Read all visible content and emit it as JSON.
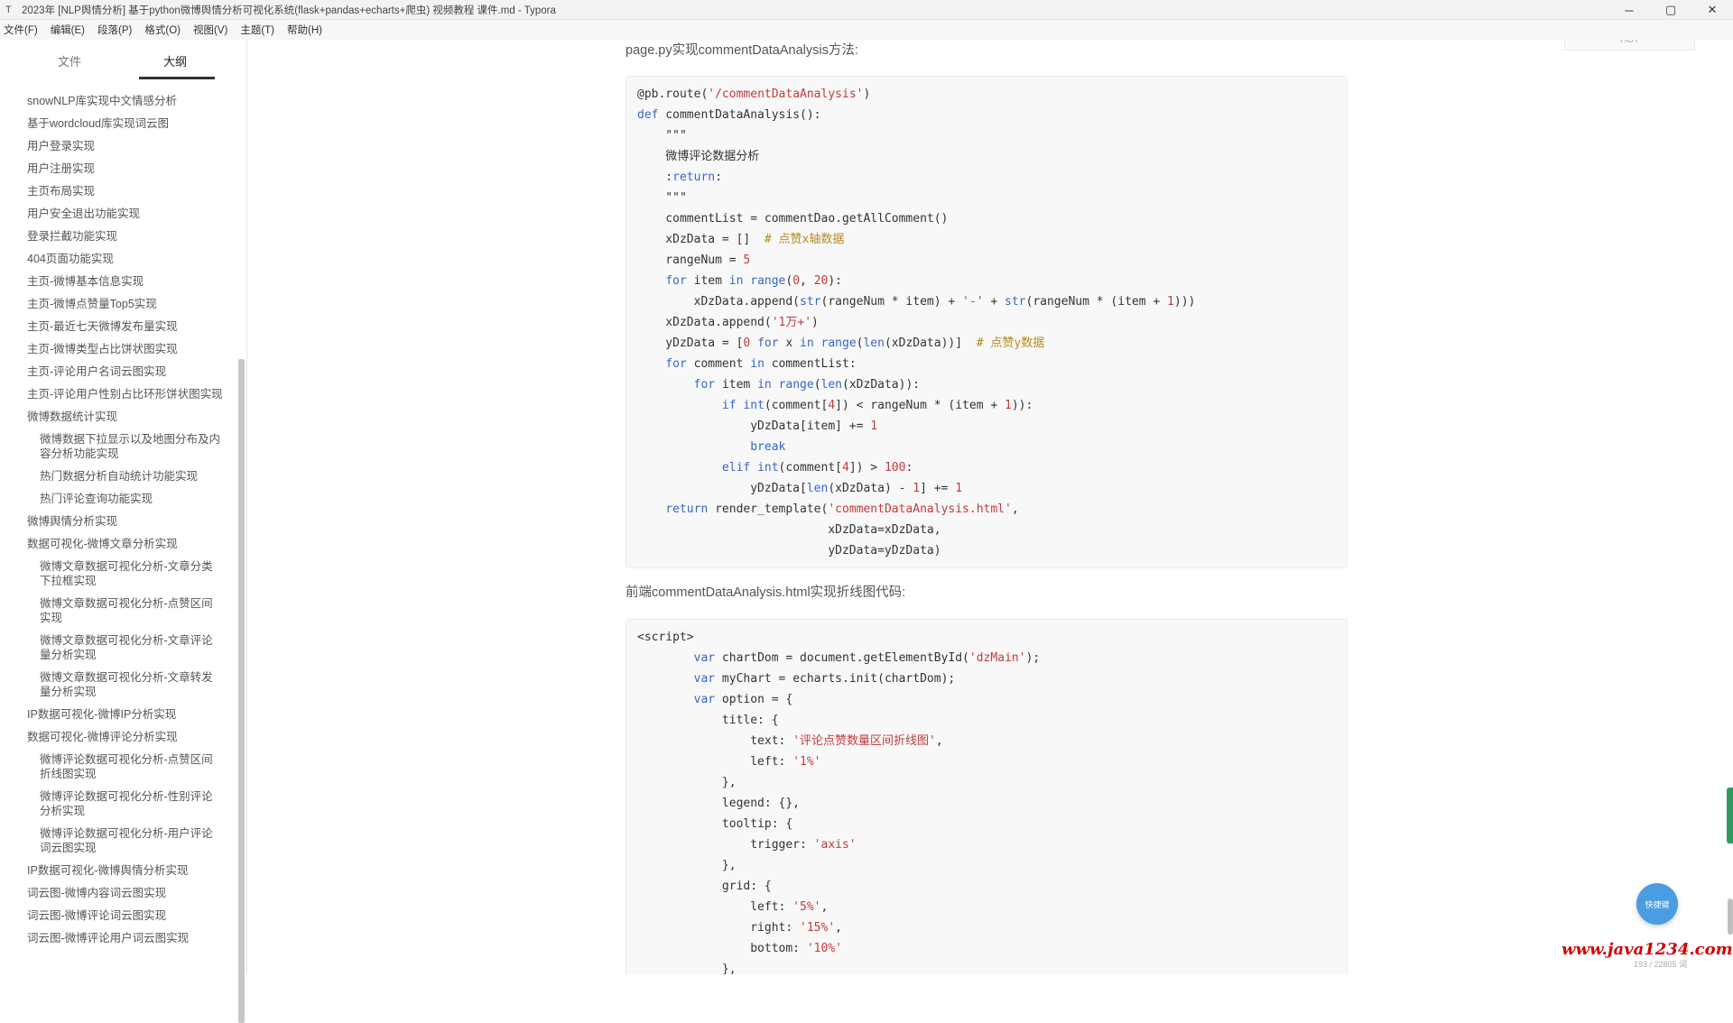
{
  "window": {
    "title": "2023年 [NLP舆情分析] 基于python微博舆情分析可视化系统(flask+pandas+echarts+爬虫) 视频教程 课件.md - Typora",
    "minimize_glyph": "─",
    "maximize_glyph": "▢",
    "close_glyph": "✕",
    "icon_glyph": "T"
  },
  "menu": {
    "items": [
      "文件(F)",
      "编辑(E)",
      "段落(P)",
      "格式(O)",
      "视图(V)",
      "主题(T)",
      "帮助(H)"
    ]
  },
  "sidebar": {
    "tab_files": "文件",
    "tab_outline": "大纲",
    "outline": [
      {
        "text": "snowNLP库实现中文情感分析",
        "level": 2
      },
      {
        "text": "基于wordcloud库实现词云图",
        "level": 2
      },
      {
        "text": "用户登录实现",
        "level": 2
      },
      {
        "text": "用户注册实现",
        "level": 2
      },
      {
        "text": "主页布局实现",
        "level": 2
      },
      {
        "text": "用户安全退出功能实现",
        "level": 2
      },
      {
        "text": "登录拦截功能实现",
        "level": 2
      },
      {
        "text": "404页面功能实现",
        "level": 2
      },
      {
        "text": "主页-微博基本信息实现",
        "level": 2
      },
      {
        "text": "主页-微博点赞量Top5实现",
        "level": 2
      },
      {
        "text": "主页-最近七天微博发布量实现",
        "level": 2
      },
      {
        "text": "主页-微博类型占比饼状图实现",
        "level": 2
      },
      {
        "text": "主页-评论用户名词云图实现",
        "level": 2
      },
      {
        "text": "主页-评论用户性别占比环形饼状图实现",
        "level": 2
      },
      {
        "text": "微博数据统计实现",
        "level": 2
      },
      {
        "text": "微博数据下拉显示以及地图分布及内容分析功能实现",
        "level": 3
      },
      {
        "text": "热门数据分析自动统计功能实现",
        "level": 3
      },
      {
        "text": "热门评论查询功能实现",
        "level": 3
      },
      {
        "text": "微博舆情分析实现",
        "level": 2
      },
      {
        "text": "数据可视化-微博文章分析实现",
        "level": 2
      },
      {
        "text": "微博文章数据可视化分析-文章分类下拉框实现",
        "level": 3
      },
      {
        "text": "微博文章数据可视化分析-点赞区间实现",
        "level": 3
      },
      {
        "text": "微博文章数据可视化分析-文章评论量分析实现",
        "level": 3
      },
      {
        "text": "微博文章数据可视化分析-文章转发量分析实现",
        "level": 3
      },
      {
        "text": "IP数据可视化-微博IP分析实现",
        "level": 2
      },
      {
        "text": "数据可视化-微博评论分析实现",
        "level": 2
      },
      {
        "text": "微博评论数据可视化分析-点赞区间折线图实现",
        "level": 3
      },
      {
        "text": "微博评论数据可视化分析-性别评论分析实现",
        "level": 3
      },
      {
        "text": "微博评论数据可视化分析-用户评论词云图实现",
        "level": 3
      },
      {
        "text": "IP数据可视化-微博舆情分析实现",
        "level": 2
      },
      {
        "text": "词云图-微博内容词云图实现",
        "level": 2
      },
      {
        "text": "词云图-微博评论词云图实现",
        "level": 2
      },
      {
        "text": "词云图-微博评论用户词云图实现",
        "level": 2
      }
    ],
    "footer_prev": "‹",
    "footer_code": "‹/›"
  },
  "editor": {
    "float_tab_label": "HOT",
    "para1": "page.py实现commentDataAnalysis方法:",
    "code1": [
      "@pb.route('/commentDataAnalysis')",
      "def commentDataAnalysis():",
      "    \"\"\"",
      "    微博评论数据分析",
      "    :return:",
      "    \"\"\"",
      "    commentList = commentDao.getAllComment()",
      "    xDzData = []  # 点赞x轴数据",
      "    rangeNum = 5",
      "    for item in range(0, 20):",
      "        xDzData.append(str(rangeNum * item) + '-' + str(rangeNum * (item + 1)))",
      "    xDzData.append('1万+')",
      "    yDzData = [0 for x in range(len(xDzData))]  # 点赞y数据",
      "    for comment in commentList:",
      "        for item in range(len(xDzData)):",
      "            if int(comment[4]) < rangeNum * (item + 1)):",
      "                yDzData[item] += 1",
      "                break",
      "            elif int(comment[4]) > 100:",
      "                yDzData[len(xDzData) - 1] += 1",
      "    return render_template('commentDataAnalysis.html',",
      "                           xDzData=xDzData,",
      "                           yDzData=yDzData)"
    ],
    "para2": "前端commentDataAnalysis.html实现折线图代码:",
    "code2": [
      "<script>",
      "        var chartDom = document.getElementById('dzMain');",
      "        var myChart = echarts.init(chartDom);",
      "        var option = {",
      "            title: {",
      "                text: '评论点赞数量区间折线图',",
      "                left: '1%'",
      "            },",
      "            legend: {},",
      "            tooltip: {",
      "                trigger: 'axis'",
      "            },",
      "            grid: {",
      "                left: '5%',",
      "                right: '15%',",
      "                bottom: '10%'",
      "            },"
    ]
  },
  "overlay": {
    "circle_label": "快捷键",
    "watermark": "www.java1234.com",
    "status_count": "193 / 22805 词"
  },
  "colors": {
    "keyword": "#3366cc",
    "string": "#c23b3b",
    "comment": "#b58a1f",
    "number": "#c23b3b"
  }
}
